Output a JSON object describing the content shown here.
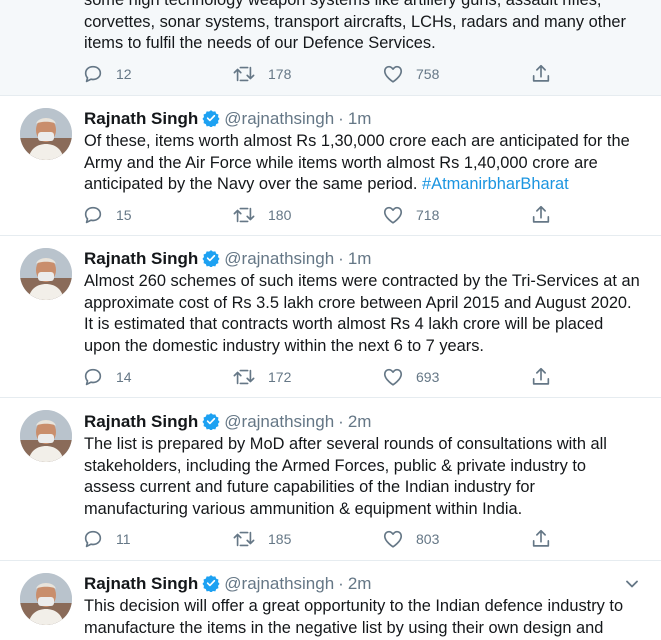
{
  "tweets": [
    {
      "partial": true,
      "text": "some high technology weapon systems like artillery guns, assault rifles, corvettes, sonar systems, transport aircrafts,  LCHs, radars and many other items to fulfil the needs of our Defence Services.",
      "lines": [
        "some high technology weapon systems like artillery guns, assault rifles,",
        "corvettes, sonar systems, transport aircrafts,  LCHs, radars and many other",
        "items to fulfil the needs of our Defence Services."
      ],
      "replies": "12",
      "retweets": "178",
      "likes": "758"
    },
    {
      "name": "Rajnath Singh",
      "handle": "@rajnathsingh",
      "sep": "·",
      "time": "1m",
      "lines": [
        "Of these, items worth almost Rs 1,30,000 crore each are anticipated for the",
        "Army and the Air Force while items worth almost Rs 1,40,000 crore are",
        "anticipated by the Navy over the same period. "
      ],
      "hashtag": "#AtmanirbharBharat",
      "replies": "15",
      "retweets": "180",
      "likes": "718"
    },
    {
      "name": "Rajnath Singh",
      "handle": "@rajnathsingh",
      "sep": "·",
      "time": "1m",
      "lines": [
        "Almost 260 schemes of such items were contracted by the Tri-Services at an",
        "approximate cost of Rs 3.5 lakh crore between April 2015 and August 2020.",
        "It is estimated that contracts worth almost Rs 4 lakh crore will be placed",
        "upon the domestic industry within the next 6 to 7 years."
      ],
      "replies": "14",
      "retweets": "172",
      "likes": "693"
    },
    {
      "name": "Rajnath Singh",
      "handle": "@rajnathsingh",
      "sep": "·",
      "time": "2m",
      "lines": [
        "The list is prepared by MoD after several rounds of consultations with all",
        "stakeholders, including  the Armed Forces, public & private industry to",
        "assess current and future  capabilities of  the  Indian industry for",
        "manufacturing various ammunition & equipment within India."
      ],
      "replies": "11",
      "retweets": "185",
      "likes": "803"
    },
    {
      "name": "Rajnath Singh",
      "handle": "@rajnathsingh",
      "sep": "·",
      "time": "2m",
      "lines": [
        "This decision will offer a great opportunity to the Indian defence industry to",
        "manufacture the items in the negative list by using their own design and"
      ]
    }
  ],
  "colors": {
    "text": "#14171a",
    "muted": "#657786",
    "link": "#1b95e0",
    "verified": "#1da1f2",
    "divider": "#e6ecf0"
  },
  "icons": {
    "reply": "reply-icon",
    "retweet": "retweet-icon",
    "like": "like-icon",
    "share": "share-icon",
    "verified": "verified-badge-icon",
    "caret": "chevron-down-icon"
  }
}
